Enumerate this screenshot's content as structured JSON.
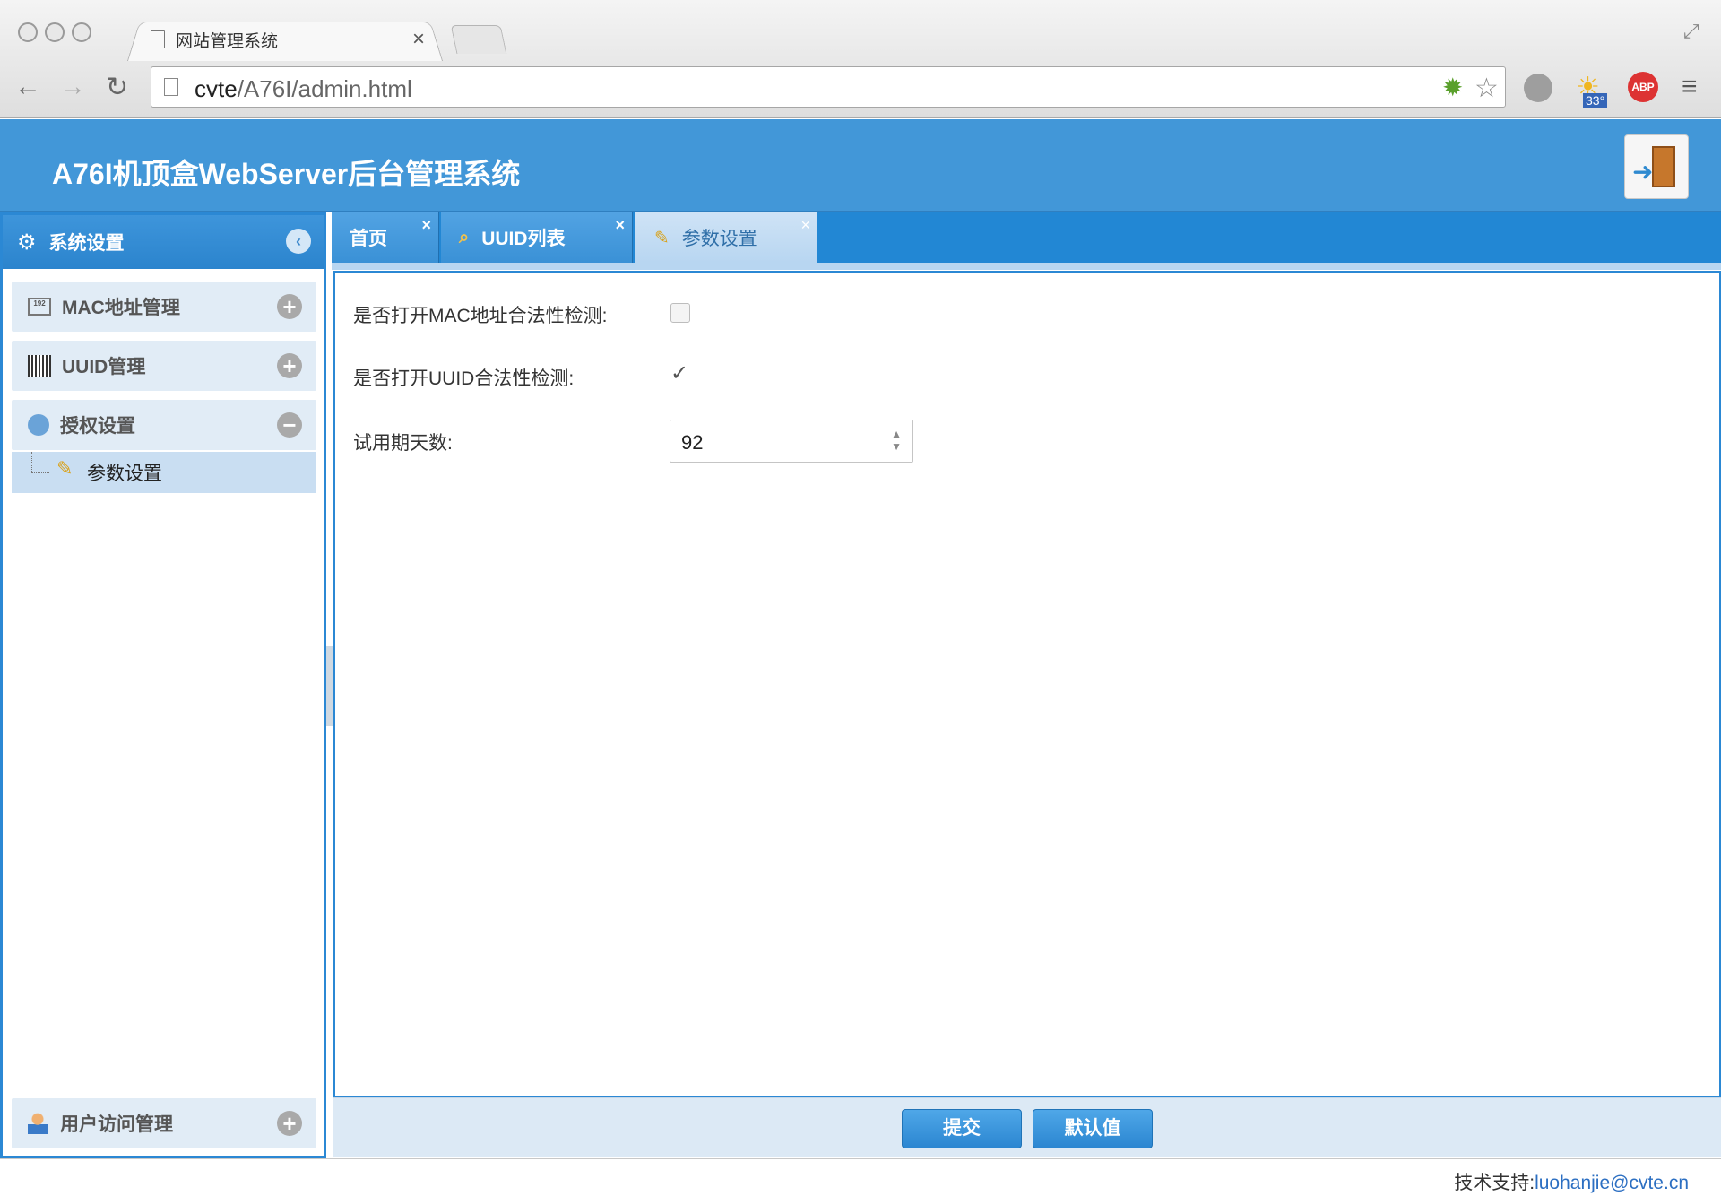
{
  "browser": {
    "tab_title": "网站管理系统",
    "url_host": "cvte",
    "url_path": "/A76I/admin.html",
    "weather_temp": "33°"
  },
  "app": {
    "title": "A76I机顶盒WebServer后台管理系统"
  },
  "sidebar": {
    "header": "系统设置",
    "groups": [
      {
        "label": "MAC地址管理"
      },
      {
        "label": "UUID管理"
      },
      {
        "label": "授权设置"
      },
      {
        "label": "用户访问管理"
      }
    ],
    "subitem": "参数设置"
  },
  "tabs": [
    {
      "label": "首页"
    },
    {
      "label": "UUID列表"
    },
    {
      "label": "参数设置"
    }
  ],
  "form": {
    "mac_check_label": "是否打开MAC地址合法性检测:",
    "mac_check_value": false,
    "uuid_check_label": "是否打开UUID合法性检测:",
    "uuid_check_value": true,
    "trial_days_label": "试用期天数:",
    "trial_days_value": "92"
  },
  "actions": {
    "submit": "提交",
    "default": "默认值"
  },
  "status": {
    "prefix": "技术支持:",
    "email": "luohanjie@cvte.cn"
  },
  "icons": {
    "close": "close-icon",
    "gear": "gear-icon",
    "collapse": "chevron-left-icon"
  }
}
